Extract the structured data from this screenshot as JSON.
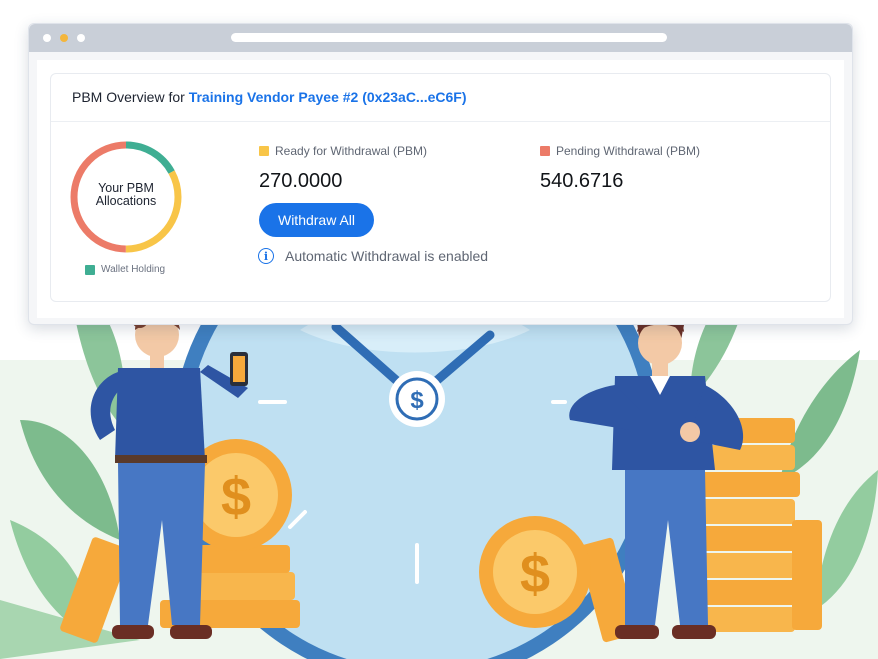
{
  "card": {
    "title_prefix": "PBM Overview for",
    "vendor_name": "Training Vendor Payee #2 (0x23aC...eC6F)"
  },
  "donut": {
    "label": "Your PBM Allocations",
    "segments": [
      {
        "name": "teal",
        "color": "#3fae93"
      },
      {
        "name": "yellow",
        "color": "#f8c548"
      },
      {
        "name": "red",
        "color": "#ec7b68"
      }
    ],
    "legend": {
      "label": "Wallet Holding",
      "color": "#3fae93"
    }
  },
  "ready": {
    "label": "Ready for Withdrawal (PBM)",
    "value": "270.0000",
    "color": "#f8c548"
  },
  "pending": {
    "label": "Pending Withdrawal (PBM)",
    "value": "540.6716",
    "color": "#ec7b68"
  },
  "actions": {
    "withdraw_label": "Withdraw All"
  },
  "info": {
    "icon": "info-icon",
    "message": "Automatic Withdrawal is enabled"
  }
}
